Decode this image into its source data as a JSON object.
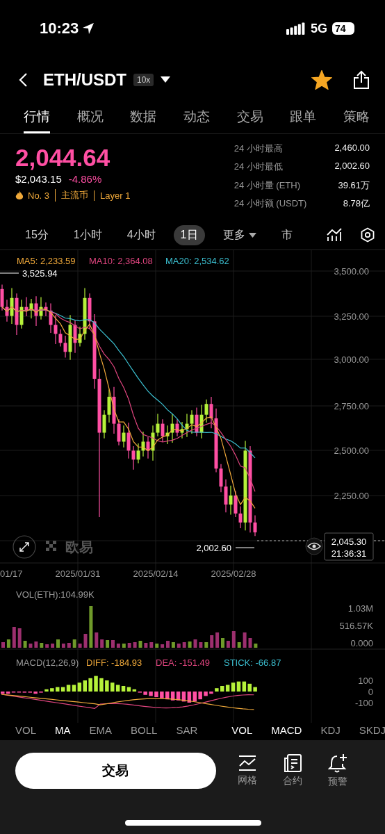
{
  "status_bar": {
    "time": "10:23",
    "network": "5G",
    "battery": "74"
  },
  "header": {
    "symbol": "ETH/USDT",
    "leverage": "10x",
    "favorite": true
  },
  "tabs": [
    {
      "label": "行情",
      "selected": true
    },
    {
      "label": "概况",
      "selected": false
    },
    {
      "label": "数据",
      "selected": false
    },
    {
      "label": "动态",
      "selected": false
    },
    {
      "label": "交易",
      "selected": false
    },
    {
      "label": "跟单",
      "selected": false
    },
    {
      "label": "策略",
      "selected": false
    }
  ],
  "ticker": {
    "price": "2,044.64",
    "usd_price": "$2,043.15",
    "change": "-4.86%",
    "tags": [
      "No. 3",
      "主流币",
      "Layer 1"
    ],
    "stats": [
      {
        "label": "24 小时最高",
        "value": "2,460.00"
      },
      {
        "label": "24 小时最低",
        "value": "2,002.60"
      },
      {
        "label": "24 小时量 (ETH)",
        "value": "39.61万"
      },
      {
        "label": "24 小时额 (USDT)",
        "value": "8.78亿"
      }
    ]
  },
  "intervals": [
    {
      "label": "15分",
      "selected": false,
      "kind": "plain"
    },
    {
      "label": "1小时",
      "selected": false,
      "kind": "plain"
    },
    {
      "label": "4小时",
      "selected": false,
      "kind": "plain"
    },
    {
      "label": "1日",
      "selected": true,
      "kind": "plain"
    },
    {
      "label": "更多",
      "selected": false,
      "kind": "dropdown"
    },
    {
      "label": "市",
      "selected": false,
      "kind": "plain"
    }
  ],
  "chart": {
    "ma": [
      {
        "label": "MA5: 2,233.59",
        "color": "#f0a93a"
      },
      {
        "label": "MA10: 2,364.08",
        "color": "#e0457f"
      },
      {
        "label": "MA20: 2,534.62",
        "color": "#3bbfd0"
      }
    ],
    "y_axis": [
      "3,500.00",
      "3,250.00",
      "3,000.00",
      "2,750.00",
      "2,500.00",
      "2,250.00"
    ],
    "high": "3,525.94",
    "low": "2,002.60",
    "last_price": "2,045.30",
    "last_time": "21:36:31",
    "logo": "欧易",
    "dates": [
      "01/17",
      "2025/01/31",
      "2025/02/14",
      "2025/02/28"
    ]
  },
  "volume": {
    "label": "VOL(ETH):104.99K",
    "y_axis": [
      "1.03M",
      "516.57K",
      "0.000"
    ]
  },
  "macd": {
    "label": "MACD(12,26,9)",
    "diff": "DIFF: -184.93",
    "dea": "DEA: -151.49",
    "stick": "STICK: -66.87",
    "y_axis": [
      "100",
      "0",
      "-100"
    ]
  },
  "main_indicators": [
    {
      "label": "VOL",
      "selected": false
    },
    {
      "label": "MA",
      "selected": true
    },
    {
      "label": "EMA",
      "selected": false
    },
    {
      "label": "BOLL",
      "selected": false
    },
    {
      "label": "SAR",
      "selected": false
    }
  ],
  "sub_indicators": [
    {
      "label": "VOL",
      "selected": true
    },
    {
      "label": "MACD",
      "selected": true
    },
    {
      "label": "KDJ",
      "selected": false
    },
    {
      "label": "SKDJ",
      "selected": false
    }
  ],
  "bottom": {
    "trade_button": "交易",
    "actions": [
      "网格",
      "合约",
      "预警"
    ]
  }
}
